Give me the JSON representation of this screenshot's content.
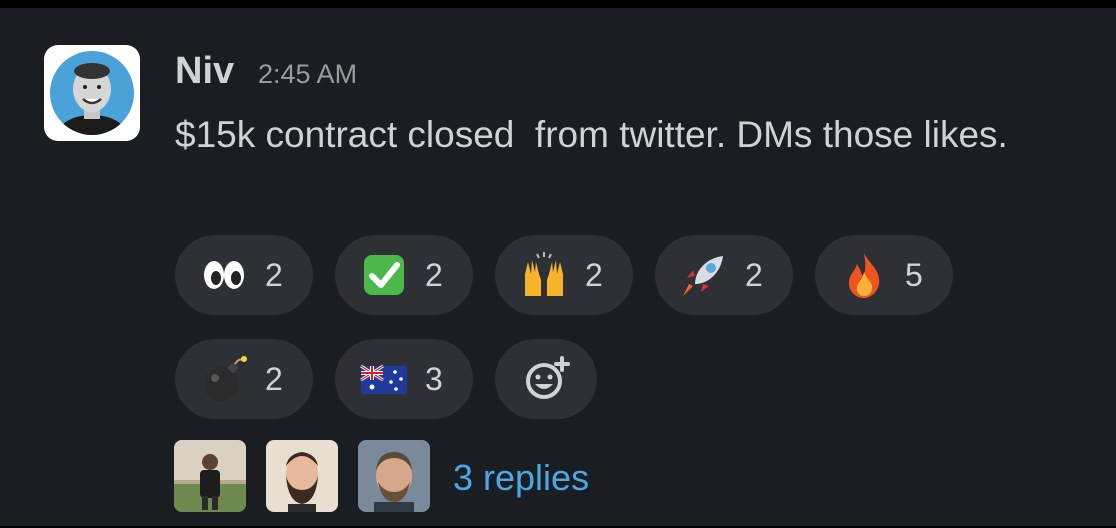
{
  "message": {
    "author": "Niv",
    "timestamp": "2:45 AM",
    "text": "$15k contract closed  from twitter. DMs those likes."
  },
  "reactions": [
    {
      "icon": "eyes-emoji",
      "count": "2"
    },
    {
      "icon": "check-mark-emoji",
      "count": "2"
    },
    {
      "icon": "raised-hands-emoji",
      "count": "2"
    },
    {
      "icon": "rocket-emoji",
      "count": "2"
    },
    {
      "icon": "fire-emoji",
      "count": "5"
    },
    {
      "icon": "bomb-emoji",
      "count": "2"
    },
    {
      "icon": "australia-flag-emoji",
      "count": "3"
    }
  ],
  "add_reaction": {
    "icon": "add-reaction-icon"
  },
  "thread": {
    "replies_label": "3 replies",
    "participants": [
      "participant-avatar-1",
      "participant-avatar-2",
      "participant-avatar-3"
    ]
  },
  "colors": {
    "background": "#1a1d21",
    "pill": "#2d3035",
    "text": "#d1d2d3",
    "link": "#4aa8e6"
  }
}
